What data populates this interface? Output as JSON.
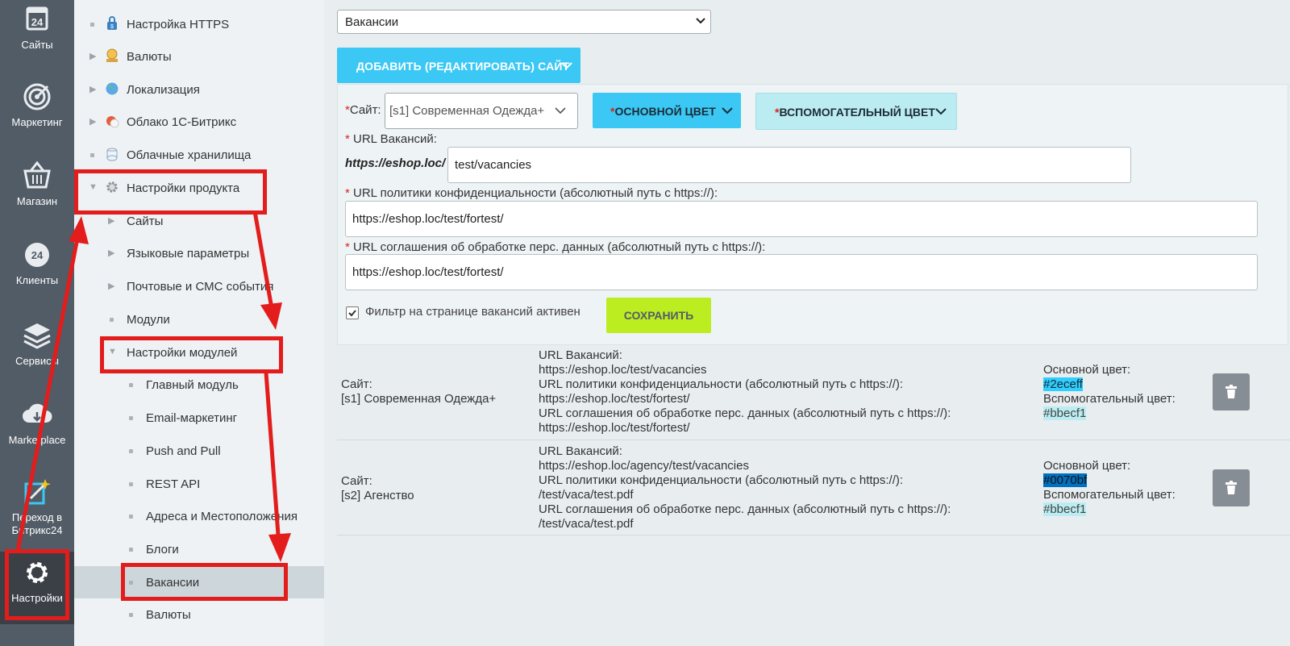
{
  "rail": [
    {
      "label": "Сайты",
      "icon": "calendar-24-icon"
    },
    {
      "label": "Маркетинг",
      "icon": "target-icon"
    },
    {
      "label": "Магазин",
      "icon": "basket-icon"
    },
    {
      "label": "Клиенты",
      "icon": "clients-24-icon"
    },
    {
      "label": "Сервисы",
      "icon": "layers-icon"
    },
    {
      "label": "Marketplace",
      "icon": "cloud-download-icon"
    },
    {
      "label": "Переход в Битрикс24",
      "icon": "magic-wand-icon"
    },
    {
      "label": "Настройки",
      "icon": "gear-icon"
    }
  ],
  "tree": [
    {
      "label": "Настройка HTTPS"
    },
    {
      "label": "Валюты"
    },
    {
      "label": "Локализация"
    },
    {
      "label": "Облако 1С-Битрикс"
    },
    {
      "label": "Облачные хранилища"
    },
    {
      "label": "Настройки продукта"
    },
    {
      "label": "Сайты"
    },
    {
      "label": "Языковые параметры"
    },
    {
      "label": "Почтовые и СМС события"
    },
    {
      "label": "Модули"
    },
    {
      "label": "Настройки модулей"
    },
    {
      "label": "Главный модуль"
    },
    {
      "label": "Email-маркетинг"
    },
    {
      "label": "Push and Pull"
    },
    {
      "label": "REST API"
    },
    {
      "label": "Адреса и Местоположения"
    },
    {
      "label": "Блоги"
    },
    {
      "label": "Вакансии"
    },
    {
      "label": "Валюты"
    }
  ],
  "top_select": {
    "value": "Вакансии"
  },
  "add_button": {
    "label": "ДОБАВИТЬ (РЕДАКТИРОВАТЬ) САЙТ"
  },
  "form": {
    "required_mark": "*",
    "site_label": "Сайт:",
    "site_value": "[s1] Современная Одежда+",
    "main_color_label": "ОСНОВНОЙ ЦВЕТ",
    "secondary_color_label": "ВСПОМОГАТЕЛЬНЫЙ ЦВЕТ",
    "url_vacancies_label": "URL Вакансий:",
    "url_prefix": "https://eshop.loc/",
    "url_vacancies_value": "test/vacancies",
    "privacy_label": "URL политики конфиденциальности (абсолютный путь с https://):",
    "privacy_value": "https://eshop.loc/test/fortest/",
    "agreement_label": "URL соглашения об обработке перс. данных (абсолютный путь с https://):",
    "agreement_value": "https://eshop.loc/test/fortest/",
    "filter_label": "Фильтр на странице вакансий активен",
    "filter_checked": true,
    "save_label": "СОХРАНИТЬ"
  },
  "rows": [
    {
      "site_label": "Сайт:",
      "site_value": "[s1] Современная Одежда+",
      "url_vac_label": "URL Вакансий:",
      "url_vac_value": "https://eshop.loc/test/vacancies",
      "privacy_label": "URL политики конфиденциальности (абсолютный путь с https://):",
      "privacy_value": "https://eshop.loc/test/fortest/",
      "agreement_label": "URL соглашения об обработке перс. данных (абсолютный путь с https://):",
      "agreement_value": "https://eshop.loc/test/fortest/",
      "main_color_label": "Основной цвет:",
      "main_color": "#2eceff",
      "secondary_color_label": "Вспомогательный цвет:",
      "secondary_color": "#bbecf1"
    },
    {
      "site_label": "Сайт:",
      "site_value": "[s2] Агенство",
      "url_vac_label": "URL Вакансий:",
      "url_vac_value": "https://eshop.loc/agency/test/vacancies",
      "privacy_label": "URL политики конфиденциальности (абсолютный путь с https://):",
      "privacy_value": "/test/vaca/test.pdf",
      "agreement_label": "URL соглашения об обработке перс. данных (абсолютный путь с https://):",
      "agreement_value": "/test/vaca/test.pdf",
      "main_color_label": "Основной цвет:",
      "main_color": "#0070bf",
      "secondary_color_label": "Вспомогательный цвет:",
      "secondary_color": "#bbecf1"
    }
  ],
  "colors": {
    "accent": "#3bc8f5",
    "save": "#bbed21",
    "annotation": "#e31c1c",
    "rail": "#525c66"
  }
}
